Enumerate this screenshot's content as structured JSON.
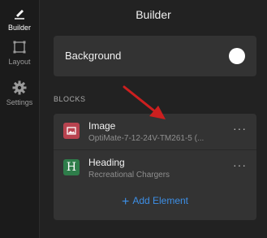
{
  "rail": {
    "items": [
      {
        "label": "Builder",
        "icon": "pencil-icon"
      },
      {
        "label": "Layout",
        "icon": "layout-icon"
      },
      {
        "label": "Settings",
        "icon": "gear-icon"
      }
    ]
  },
  "panel": {
    "title": "Builder",
    "background_label": "Background",
    "section_label": "BLOCKS",
    "blocks": [
      {
        "name": "Image",
        "subtitle": "OptiMate-7-12-24V-TM261-5 (...",
        "icon": "image-icon",
        "icon_color": "#b8434f",
        "more": "···"
      },
      {
        "name": "Heading",
        "subtitle": "Recreational Chargers",
        "icon": "heading-icon",
        "icon_glyph": "H",
        "icon_color": "#2e7d4a",
        "more": "···"
      }
    ],
    "add_label": "Add Element",
    "add_icon": "+"
  },
  "colors": {
    "accent": "#3d8fe6",
    "annotation_arrow": "#cc1f1f"
  }
}
